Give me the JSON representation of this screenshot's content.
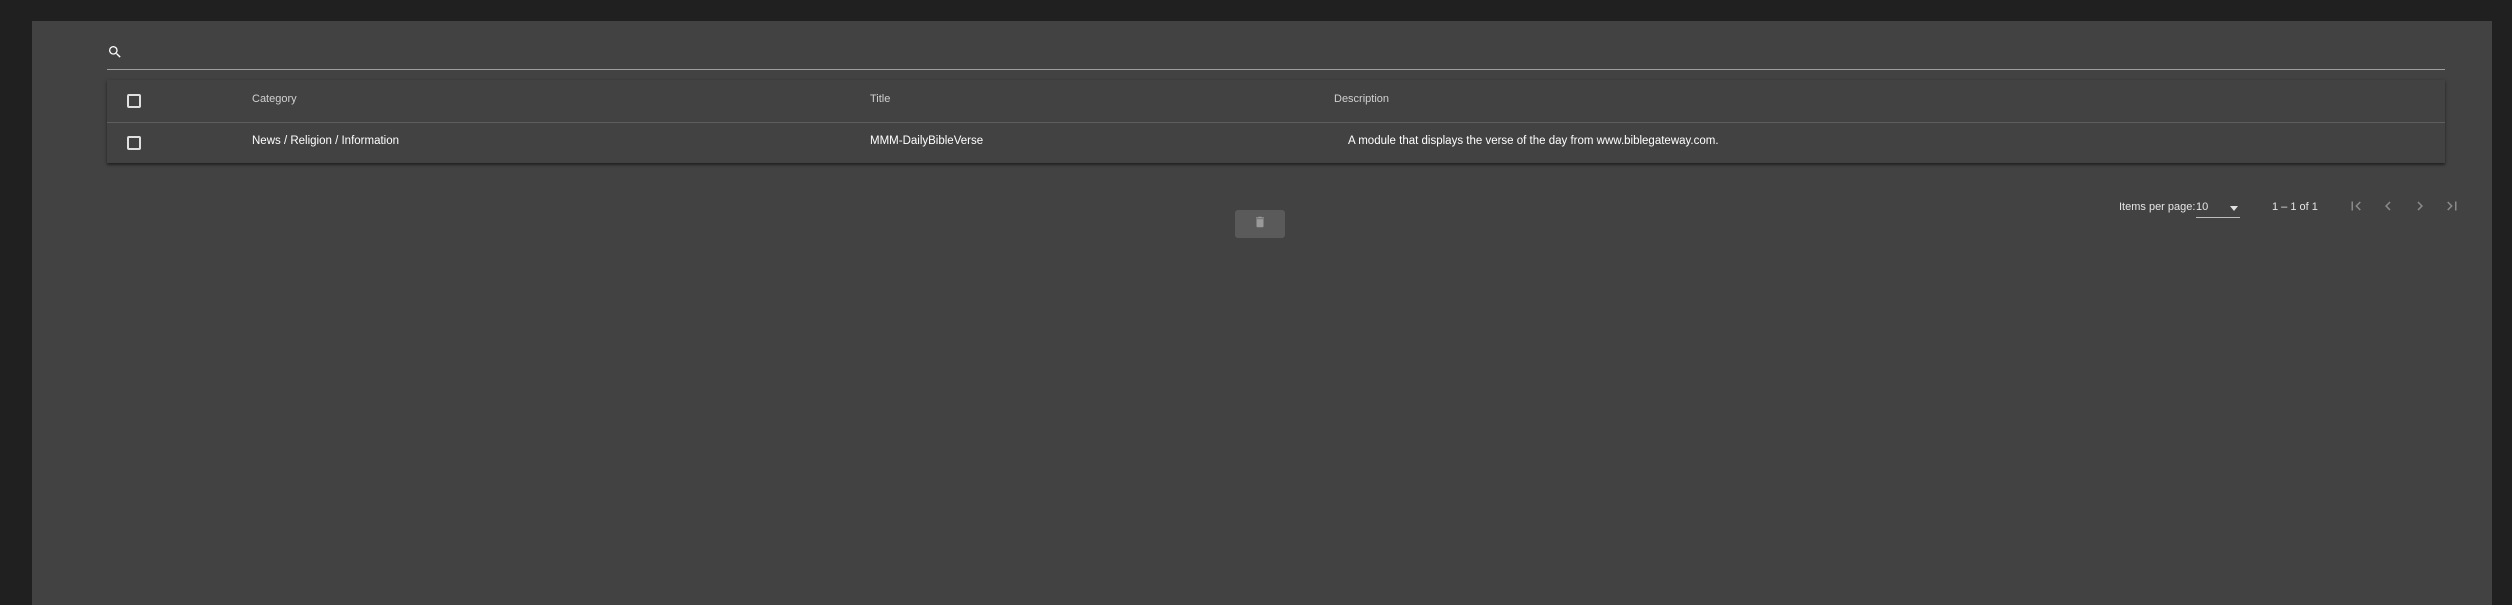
{
  "search": {
    "placeholder": "",
    "value": ""
  },
  "table": {
    "columns": [
      "Category",
      "Title",
      "Description"
    ],
    "rows": [
      {
        "category": "News / Religion / Information",
        "title": "MMM-DailyBibleVerse",
        "description": "A module that displays the verse of the day from www.biblegateway.com."
      }
    ]
  },
  "paginator": {
    "items_per_page_label": "Items per page:",
    "items_per_page_value": "10",
    "range_label": "1 – 1 of 1"
  },
  "icons": {
    "search": "search-icon",
    "first_page": "first-page-icon",
    "prev_page": "chevron-left-icon",
    "next_page": "chevron-right-icon",
    "last_page": "last-page-icon",
    "delete": "trash-icon"
  },
  "colors": {
    "background": "#202020",
    "card": "#424242",
    "text": "#ffffff",
    "button": "#5a5a5a"
  }
}
